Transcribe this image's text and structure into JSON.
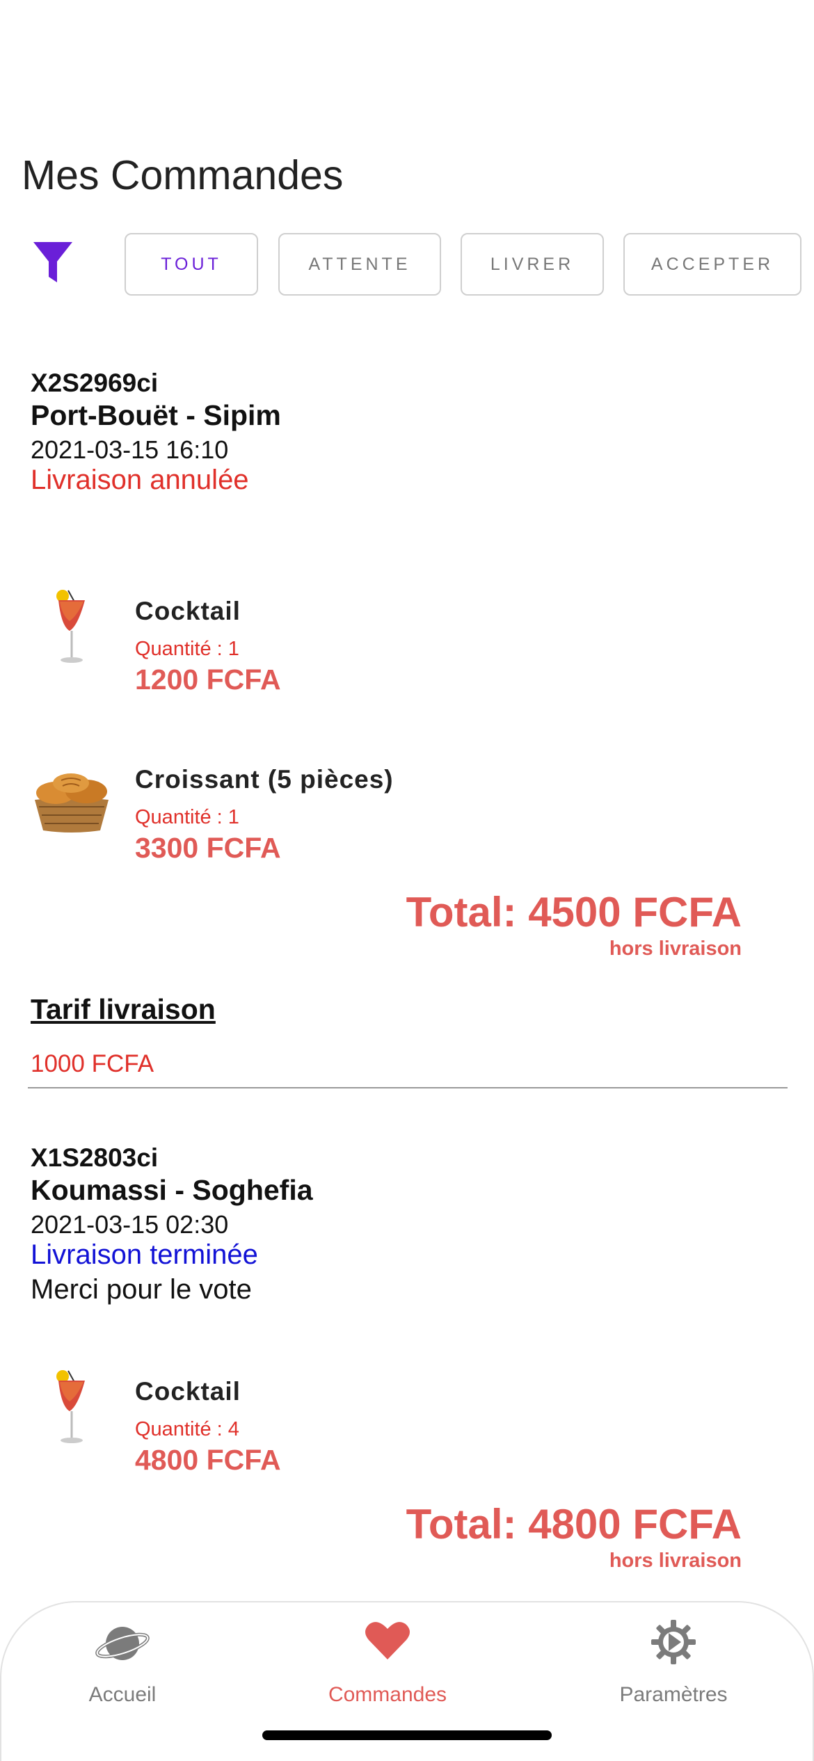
{
  "header": {
    "title": "Mes Commandes"
  },
  "filters": {
    "icon": "filter-icon",
    "accent": "#6a1fd8",
    "chips": [
      {
        "label": "TOUT",
        "active": true
      },
      {
        "label": "ATTENTE",
        "active": false
      },
      {
        "label": "LIVRER",
        "active": false
      },
      {
        "label": "ACCEPTER",
        "active": false
      }
    ]
  },
  "orders": [
    {
      "ref": "X2S2969ci",
      "place": "Port-Bouët - Sipim",
      "date": "2021-03-15 16:10",
      "status": "Livraison annulée",
      "status_color": "#e0302a",
      "items": [
        {
          "name": "Cocktail",
          "qty": "Quantité : 1",
          "price": "1200 FCFA",
          "icon": "cocktail-icon"
        },
        {
          "name": "Croissant (5 pièces)",
          "qty": "Quantité : 1",
          "price": "3300 FCFA",
          "icon": "croissant-icon"
        }
      ],
      "total": "Total: 4500 FCFA",
      "total_note": "hors livraison"
    },
    {
      "ref": "X1S2803ci",
      "place": "Koumassi - Soghefia",
      "date": "2021-03-15 02:30",
      "status": "Livraison terminée",
      "status_color": "#1212d6",
      "note": "Merci pour le vote",
      "items": [
        {
          "name": "Cocktail",
          "qty": "Quantité : 4",
          "price": "4800 FCFA",
          "icon": "cocktail-icon"
        }
      ],
      "total": "Total: 4800 FCFA",
      "total_note": "hors livraison"
    }
  ],
  "delivery": {
    "title": "Tarif livraison",
    "value": "1000 FCFA"
  },
  "tabbar": {
    "active_color": "#e05a56",
    "tabs": [
      {
        "label": "Accueil",
        "icon": "planet-icon"
      },
      {
        "label": "Commandes",
        "icon": "heart-icon"
      },
      {
        "label": "Paramètres",
        "icon": "gear-icon"
      }
    ]
  }
}
